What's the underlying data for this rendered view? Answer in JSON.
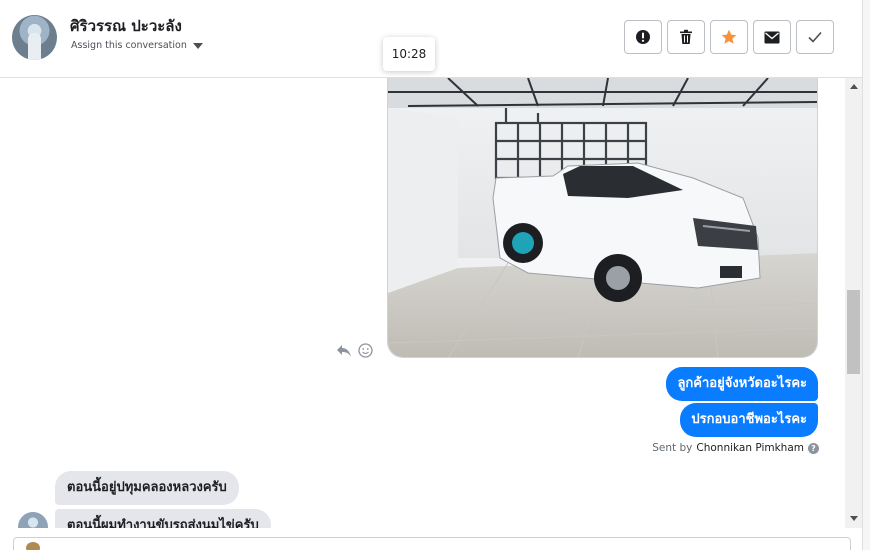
{
  "header": {
    "contact_name": "ศิริวรรณ ปะวะลัง",
    "assign_label": "Assign this conversation",
    "actions": [
      {
        "icon": "exclamation-icon",
        "label": ""
      },
      {
        "icon": "trash-icon",
        "label": ""
      },
      {
        "icon": "star-icon",
        "label": "",
        "color": "#f7923a"
      },
      {
        "icon": "envelope-icon",
        "label": ""
      },
      {
        "icon": "checkmark-icon",
        "label": ""
      }
    ]
  },
  "tooltip": {
    "time": "10:28"
  },
  "thread": {
    "image": {
      "description_icon": "truck-photo"
    },
    "outgoing": [
      "ลูกค้าอยู่จังหวัดอะไรคะ",
      "ปรกอบอาชีพอะไรคะ"
    ],
    "sent_by_prefix": "Sent by",
    "sent_by_agent": "Chonnikan Pimkham",
    "incoming": [
      "ตอนนี้อยู่ปทุมคลองหลวงครับ",
      "ตอนนี้ผมทำงานขับรถส่งนมไข่ครับ"
    ]
  },
  "colors": {
    "accent": "#0a7cff",
    "incoming_bubble": "#e4e6eb",
    "star": "#f7923a"
  }
}
